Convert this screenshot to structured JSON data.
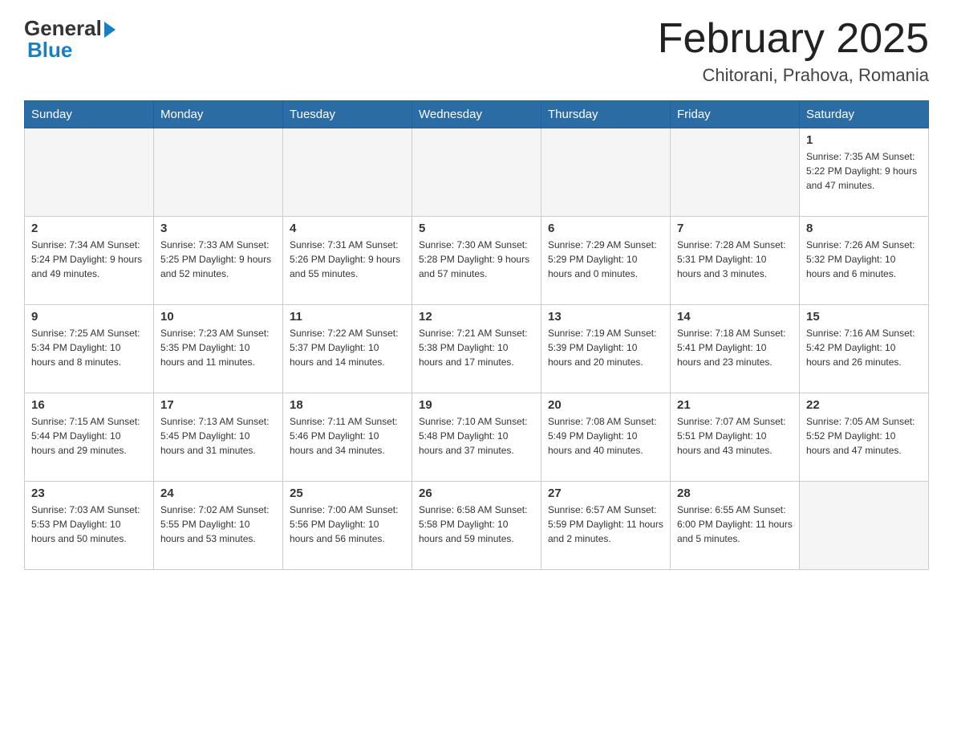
{
  "logo": {
    "text_general": "General",
    "text_blue": "Blue"
  },
  "title": "February 2025",
  "subtitle": "Chitorani, Prahova, Romania",
  "calendar": {
    "headers": [
      "Sunday",
      "Monday",
      "Tuesday",
      "Wednesday",
      "Thursday",
      "Friday",
      "Saturday"
    ],
    "rows": [
      [
        {
          "day": "",
          "info": "",
          "empty": true
        },
        {
          "day": "",
          "info": "",
          "empty": true
        },
        {
          "day": "",
          "info": "",
          "empty": true
        },
        {
          "day": "",
          "info": "",
          "empty": true
        },
        {
          "day": "",
          "info": "",
          "empty": true
        },
        {
          "day": "",
          "info": "",
          "empty": true
        },
        {
          "day": "1",
          "info": "Sunrise: 7:35 AM\nSunset: 5:22 PM\nDaylight: 9 hours\nand 47 minutes.",
          "empty": false
        }
      ],
      [
        {
          "day": "2",
          "info": "Sunrise: 7:34 AM\nSunset: 5:24 PM\nDaylight: 9 hours\nand 49 minutes.",
          "empty": false
        },
        {
          "day": "3",
          "info": "Sunrise: 7:33 AM\nSunset: 5:25 PM\nDaylight: 9 hours\nand 52 minutes.",
          "empty": false
        },
        {
          "day": "4",
          "info": "Sunrise: 7:31 AM\nSunset: 5:26 PM\nDaylight: 9 hours\nand 55 minutes.",
          "empty": false
        },
        {
          "day": "5",
          "info": "Sunrise: 7:30 AM\nSunset: 5:28 PM\nDaylight: 9 hours\nand 57 minutes.",
          "empty": false
        },
        {
          "day": "6",
          "info": "Sunrise: 7:29 AM\nSunset: 5:29 PM\nDaylight: 10 hours\nand 0 minutes.",
          "empty": false
        },
        {
          "day": "7",
          "info": "Sunrise: 7:28 AM\nSunset: 5:31 PM\nDaylight: 10 hours\nand 3 minutes.",
          "empty": false
        },
        {
          "day": "8",
          "info": "Sunrise: 7:26 AM\nSunset: 5:32 PM\nDaylight: 10 hours\nand 6 minutes.",
          "empty": false
        }
      ],
      [
        {
          "day": "9",
          "info": "Sunrise: 7:25 AM\nSunset: 5:34 PM\nDaylight: 10 hours\nand 8 minutes.",
          "empty": false
        },
        {
          "day": "10",
          "info": "Sunrise: 7:23 AM\nSunset: 5:35 PM\nDaylight: 10 hours\nand 11 minutes.",
          "empty": false
        },
        {
          "day": "11",
          "info": "Sunrise: 7:22 AM\nSunset: 5:37 PM\nDaylight: 10 hours\nand 14 minutes.",
          "empty": false
        },
        {
          "day": "12",
          "info": "Sunrise: 7:21 AM\nSunset: 5:38 PM\nDaylight: 10 hours\nand 17 minutes.",
          "empty": false
        },
        {
          "day": "13",
          "info": "Sunrise: 7:19 AM\nSunset: 5:39 PM\nDaylight: 10 hours\nand 20 minutes.",
          "empty": false
        },
        {
          "day": "14",
          "info": "Sunrise: 7:18 AM\nSunset: 5:41 PM\nDaylight: 10 hours\nand 23 minutes.",
          "empty": false
        },
        {
          "day": "15",
          "info": "Sunrise: 7:16 AM\nSunset: 5:42 PM\nDaylight: 10 hours\nand 26 minutes.",
          "empty": false
        }
      ],
      [
        {
          "day": "16",
          "info": "Sunrise: 7:15 AM\nSunset: 5:44 PM\nDaylight: 10 hours\nand 29 minutes.",
          "empty": false
        },
        {
          "day": "17",
          "info": "Sunrise: 7:13 AM\nSunset: 5:45 PM\nDaylight: 10 hours\nand 31 minutes.",
          "empty": false
        },
        {
          "day": "18",
          "info": "Sunrise: 7:11 AM\nSunset: 5:46 PM\nDaylight: 10 hours\nand 34 minutes.",
          "empty": false
        },
        {
          "day": "19",
          "info": "Sunrise: 7:10 AM\nSunset: 5:48 PM\nDaylight: 10 hours\nand 37 minutes.",
          "empty": false
        },
        {
          "day": "20",
          "info": "Sunrise: 7:08 AM\nSunset: 5:49 PM\nDaylight: 10 hours\nand 40 minutes.",
          "empty": false
        },
        {
          "day": "21",
          "info": "Sunrise: 7:07 AM\nSunset: 5:51 PM\nDaylight: 10 hours\nand 43 minutes.",
          "empty": false
        },
        {
          "day": "22",
          "info": "Sunrise: 7:05 AM\nSunset: 5:52 PM\nDaylight: 10 hours\nand 47 minutes.",
          "empty": false
        }
      ],
      [
        {
          "day": "23",
          "info": "Sunrise: 7:03 AM\nSunset: 5:53 PM\nDaylight: 10 hours\nand 50 minutes.",
          "empty": false
        },
        {
          "day": "24",
          "info": "Sunrise: 7:02 AM\nSunset: 5:55 PM\nDaylight: 10 hours\nand 53 minutes.",
          "empty": false
        },
        {
          "day": "25",
          "info": "Sunrise: 7:00 AM\nSunset: 5:56 PM\nDaylight: 10 hours\nand 56 minutes.",
          "empty": false
        },
        {
          "day": "26",
          "info": "Sunrise: 6:58 AM\nSunset: 5:58 PM\nDaylight: 10 hours\nand 59 minutes.",
          "empty": false
        },
        {
          "day": "27",
          "info": "Sunrise: 6:57 AM\nSunset: 5:59 PM\nDaylight: 11 hours\nand 2 minutes.",
          "empty": false
        },
        {
          "day": "28",
          "info": "Sunrise: 6:55 AM\nSunset: 6:00 PM\nDaylight: 11 hours\nand 5 minutes.",
          "empty": false
        },
        {
          "day": "",
          "info": "",
          "empty": true
        }
      ]
    ]
  }
}
